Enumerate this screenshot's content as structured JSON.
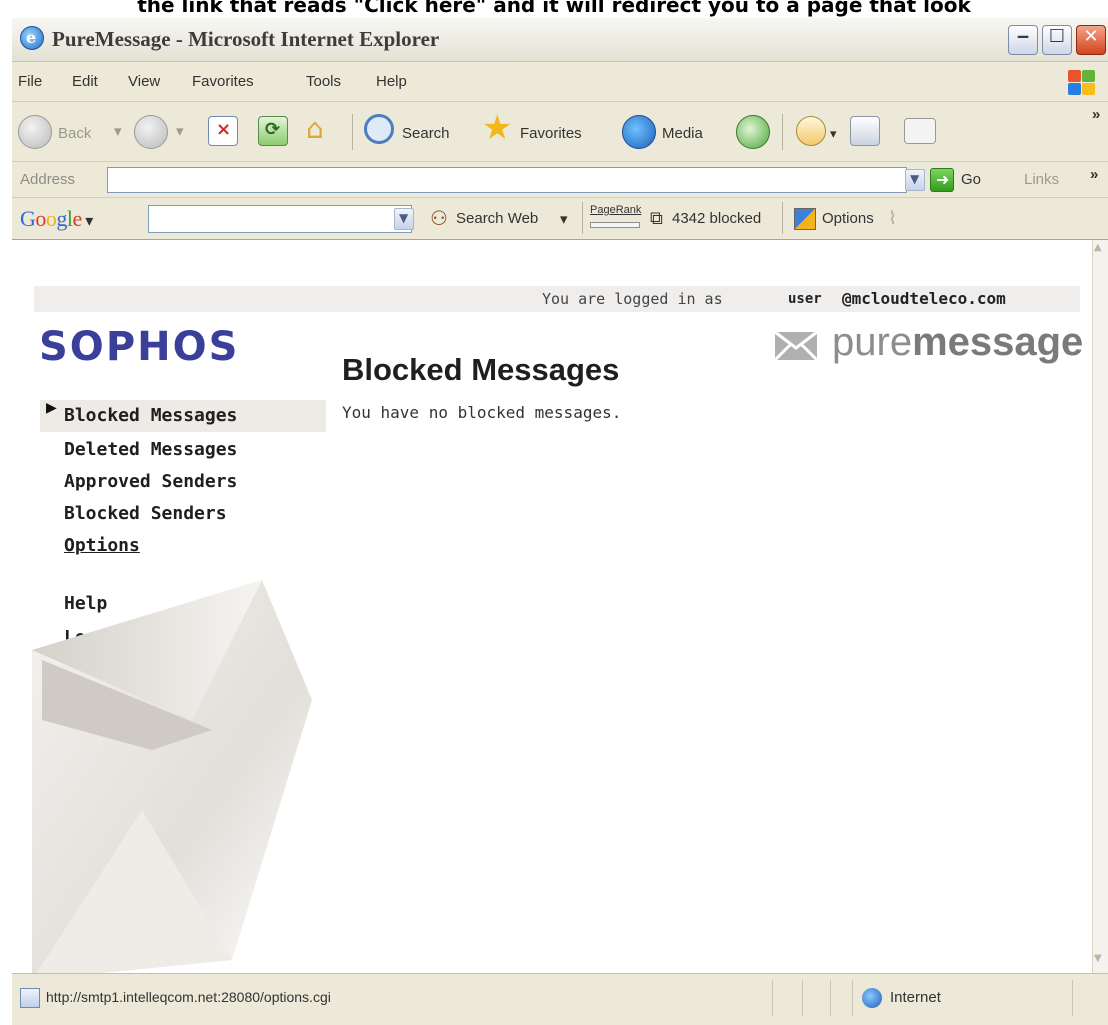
{
  "caption": "the link that reads \"Click here\" and it will redirect you to a page that look",
  "window": {
    "title": "PureMessage - Microsoft Internet Explorer"
  },
  "menubar": {
    "items": [
      "File",
      "Edit",
      "View",
      "Favorites",
      "Tools",
      "Help"
    ]
  },
  "toolbar": {
    "back": "Back",
    "search": "Search",
    "favorites": "Favorites",
    "media": "Media"
  },
  "addressbar": {
    "label": "Address",
    "value": "",
    "go": "Go",
    "links": "Links"
  },
  "googlebar": {
    "logo": "Google",
    "search_web": "Search Web",
    "pagerank": "PageRank",
    "blocked": "4342 blocked",
    "options": "Options"
  },
  "page": {
    "logged_in_prefix": "You are logged in as",
    "user": "user",
    "domain": "@mcloudteleco.com",
    "brand_left": "SOPHOS",
    "brand_right_pure": "pure",
    "brand_right_message": "message",
    "title": "Blocked Messages",
    "message": "You have no blocked messages.",
    "nav": [
      {
        "label": "Blocked Messages"
      },
      {
        "label": "Deleted Messages"
      },
      {
        "label": "Approved Senders"
      },
      {
        "label": "Blocked Senders"
      },
      {
        "label": "Options"
      },
      {
        "label": "Help"
      },
      {
        "label": "Log Out"
      }
    ]
  },
  "statusbar": {
    "url": "http://smtp1.intelleqcom.net:28080/options.cgi",
    "zone": "Internet"
  },
  "colors": {
    "sophos_brand": "#3a3f9a",
    "chrome": "#ECE9D8"
  }
}
